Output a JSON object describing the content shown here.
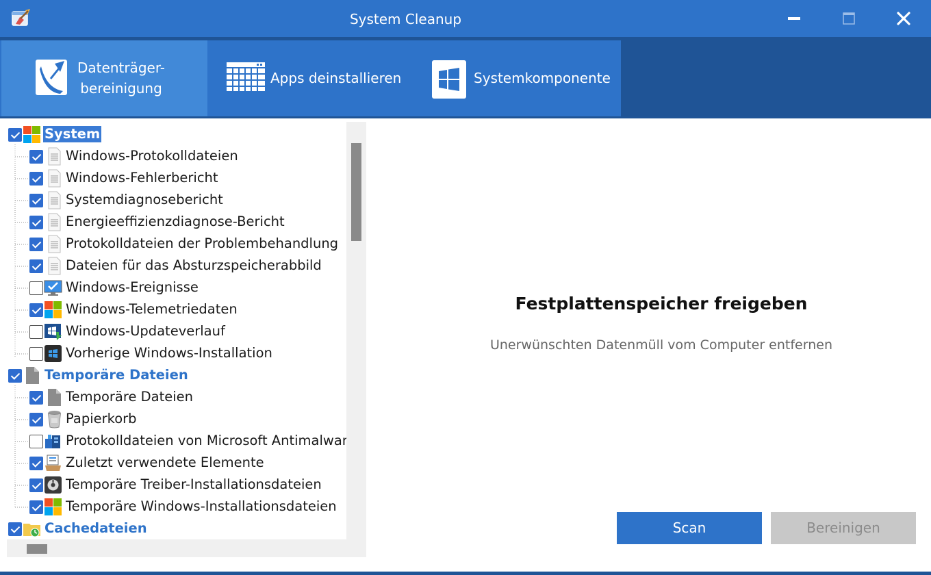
{
  "window": {
    "title": "System Cleanup"
  },
  "tabs": [
    {
      "label_line1": "Datenträger-",
      "label_line2": "bereinigung"
    },
    {
      "label": "Apps deinstallieren"
    },
    {
      "label": "Systemkomponente"
    }
  ],
  "tree": {
    "system": {
      "label": "System",
      "checked": true,
      "items": [
        {
          "label": "Windows-Protokolldateien",
          "checked": true,
          "icon": "document-icon"
        },
        {
          "label": "Windows-Fehlerbericht",
          "checked": true,
          "icon": "document-icon"
        },
        {
          "label": "Systemdiagnosebericht",
          "checked": true,
          "icon": "document-icon"
        },
        {
          "label": "Energieeffizienzdiagnose-Bericht",
          "checked": true,
          "icon": "document-icon"
        },
        {
          "label": "Protokolldateien der Problembehandlung",
          "checked": true,
          "icon": "document-icon"
        },
        {
          "label": "Dateien für das Absturzspeicherabbild",
          "checked": true,
          "icon": "document-icon"
        },
        {
          "label": "Windows-Ereignisse",
          "checked": false,
          "icon": "monitor-check-icon"
        },
        {
          "label": "Windows-Telemetriedaten",
          "checked": true,
          "icon": "windows-logo-icon"
        },
        {
          "label": "Windows-Updateverlauf",
          "checked": false,
          "icon": "windows-update-icon"
        },
        {
          "label": "Vorherige Windows-Installation",
          "checked": false,
          "icon": "windows-dark-icon"
        }
      ]
    },
    "temp": {
      "label": "Temporäre Dateien",
      "checked": true,
      "items": [
        {
          "label": "Temporäre Dateien",
          "checked": true,
          "icon": "gray-file-icon"
        },
        {
          "label": "Papierkorb",
          "checked": true,
          "icon": "recycle-bin-icon"
        },
        {
          "label": "Protokolldateien von Microsoft Antimalware",
          "checked": false,
          "icon": "antimalware-icon"
        },
        {
          "label": "Zuletzt verwendete Elemente",
          "checked": true,
          "icon": "recent-items-icon"
        },
        {
          "label": "Temporäre Treiber-Installationsdateien",
          "checked": true,
          "icon": "driver-icon"
        },
        {
          "label": "Temporäre Windows-Installationsdateien",
          "checked": true,
          "icon": "windows-logo-icon"
        }
      ]
    },
    "cache": {
      "label": "Cachedateien",
      "checked": true
    }
  },
  "main": {
    "title": "Festplattenspeicher freigeben",
    "subtitle": "Unerwünschten Datenmüll vom Computer entfernen",
    "scan_label": "Scan",
    "clean_label": "Bereinigen"
  },
  "colors": {
    "titlebar": "#2e73c9",
    "tabbar_dark": "#1f5496",
    "tab_active": "#4189d8",
    "accent": "#2e73c9",
    "button_disabled": "#c8c8c8"
  }
}
